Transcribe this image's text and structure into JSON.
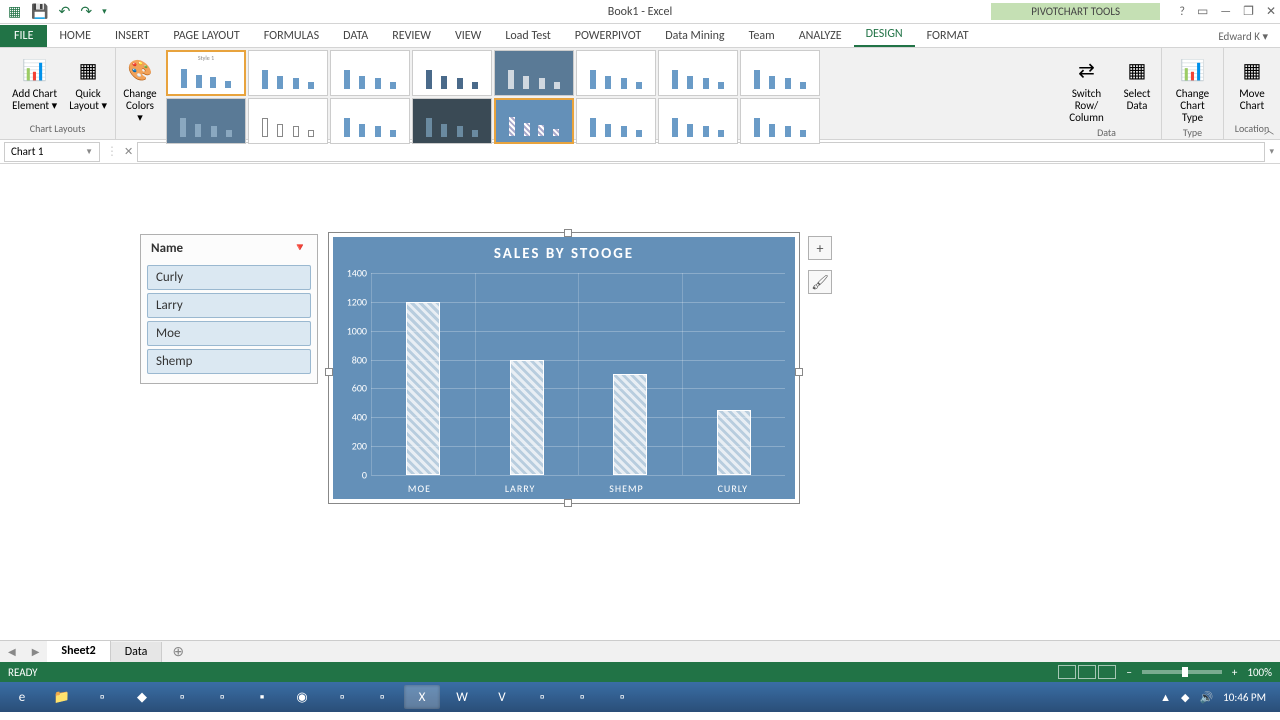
{
  "title_bar": {
    "app_title": "Book1 - Excel",
    "tools_title": "PIVOTCHART TOOLS"
  },
  "tabs": {
    "file": "FILE",
    "home": "HOME",
    "insert": "INSERT",
    "page_layout": "PAGE LAYOUT",
    "formulas": "FORMULAS",
    "data": "DATA",
    "review": "REVIEW",
    "view": "VIEW",
    "load_test": "Load Test",
    "powerpivot": "POWERPIVOT",
    "data_mining": "Data Mining",
    "team": "Team",
    "analyze": "ANALYZE",
    "design": "DESIGN",
    "format": "FORMAT",
    "account": "Edward K ▾"
  },
  "ribbon": {
    "add_chart_element": "Add Chart Element ▾",
    "quick_layout": "Quick Layout ▾",
    "change_colors": "Change Colors ▾",
    "chart_layouts": "Chart Layouts",
    "switch_row_col": "Switch Row/ Column",
    "select_data": "Select Data",
    "data_group": "Data",
    "change_chart_type": "Change Chart Type",
    "type_group": "Type",
    "move_chart": "Move Chart",
    "location_group": "Location"
  },
  "name_box": "Chart 1",
  "slicer": {
    "header": "Name",
    "items": [
      "Curly",
      "Larry",
      "Moe",
      "Shemp"
    ]
  },
  "chart_data": {
    "type": "bar",
    "title": "SALES BY STOOGE",
    "categories": [
      "MOE",
      "LARRY",
      "SHEMP",
      "CURLY"
    ],
    "values": [
      1200,
      800,
      700,
      450
    ],
    "ylim": [
      0,
      1400
    ],
    "yticks": [
      0,
      200,
      400,
      600,
      800,
      1000,
      1200,
      1400
    ]
  },
  "sheets": {
    "active": "Sheet2",
    "other": "Data"
  },
  "status": {
    "ready": "READY",
    "zoom": "100%"
  },
  "taskbar": {
    "time": "10:46 PM"
  }
}
